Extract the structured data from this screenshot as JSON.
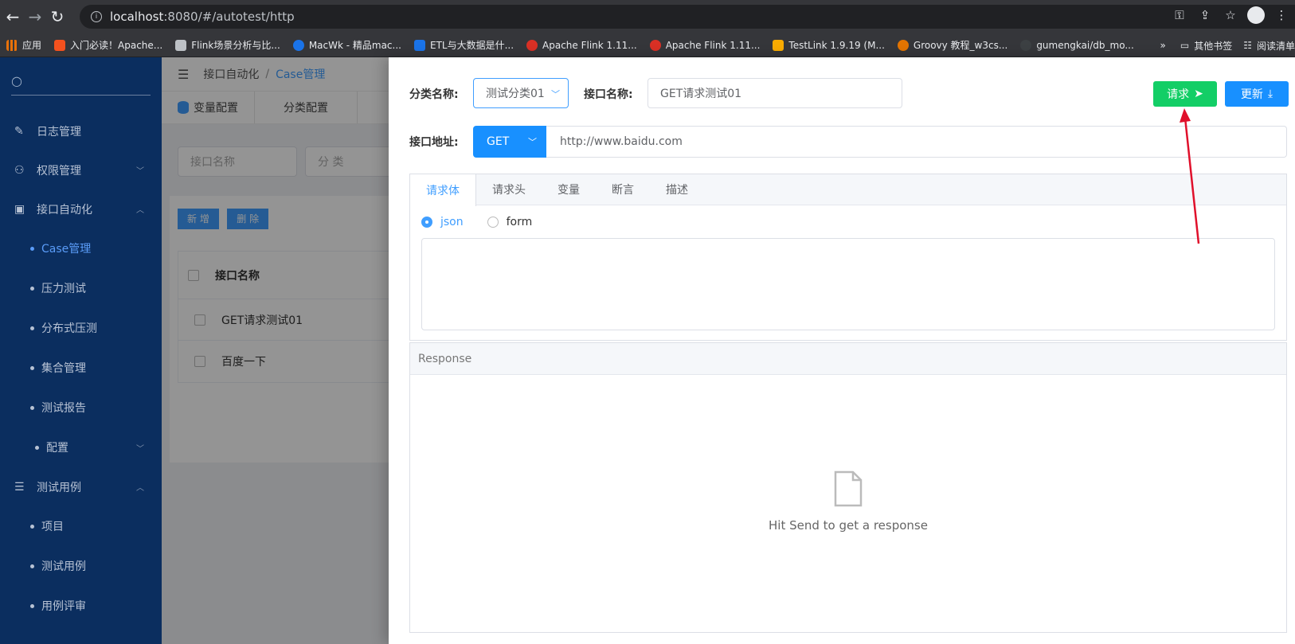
{
  "browser": {
    "url_host": "localhost",
    "url_rest": ":8080/#/autotest/http",
    "bookmarks": [
      {
        "label": "应用",
        "color": "#e8710a"
      },
      {
        "label": "入门必读！Apache...",
        "color": "#f4511e"
      },
      {
        "label": "Flink场景分析与比...",
        "color": "#bdc1c6"
      },
      {
        "label": "MacWk - 精品mac...",
        "color": "#1a73e8"
      },
      {
        "label": "ETL与大数据是什...",
        "color": "#1a73e8"
      },
      {
        "label": "Apache Flink 1.11...",
        "color": "#d93025"
      },
      {
        "label": "Apache Flink 1.11...",
        "color": "#d93025"
      },
      {
        "label": "TestLink 1.9.19 (M...",
        "color": "#f9ab00"
      },
      {
        "label": "Groovy 教程_w3cs...",
        "color": "#e37400"
      },
      {
        "label": "gumengkai/db_mo...",
        "color": "#3c4043"
      }
    ],
    "bookmarks_more": "»",
    "other_bookmarks": "其他书签",
    "reading_list": "阅读清单"
  },
  "sidebar": {
    "items": [
      {
        "label": "日志管理",
        "icon": "edit-icon"
      },
      {
        "label": "权限管理",
        "icon": "user-lock-icon"
      },
      {
        "label": "接口自动化",
        "icon": "api-icon"
      }
    ],
    "subitems": [
      {
        "label": "Case管理",
        "active": true
      },
      {
        "label": "压力测试"
      },
      {
        "label": "分布式压测"
      },
      {
        "label": "集合管理"
      },
      {
        "label": "测试报告"
      }
    ],
    "config_label": "配置",
    "testcase_group": "测试用例",
    "testcase_subitems": [
      "项目",
      "测试用例",
      "用例评审"
    ]
  },
  "main": {
    "breadcrumb_root": "接口自动化",
    "breadcrumb_sep": "/",
    "breadcrumb_current": "Case管理",
    "tabs": [
      "变量配置",
      "分类配置"
    ],
    "filter_name_placeholder": "接口名称",
    "filter_cat_placeholder": "分 类",
    "btn_add": "新 增",
    "btn_delete": "删 除",
    "table_header": "接口名称",
    "rows": [
      "GET请求测试01",
      "百度一下"
    ]
  },
  "drawer": {
    "category_label": "分类名称:",
    "category_value": "测试分类01",
    "name_label": "接口名称:",
    "name_value": "GET请求测试01",
    "send_label": "请求",
    "update_label": "更新",
    "url_label": "接口地址:",
    "method": "GET",
    "url": "http://www.baidu.com",
    "tabs": [
      "请求体",
      "请求头",
      "变量",
      "断言",
      "描述"
    ],
    "body_types": [
      "json",
      "form"
    ],
    "response_header": "Response",
    "response_empty": "Hit Send to get a response"
  },
  "colors": {
    "sidebar_bg": "#0b2e5f",
    "accent": "#409eff",
    "send_button": "#13ce66",
    "annotation_arrow": "#e0102b"
  }
}
